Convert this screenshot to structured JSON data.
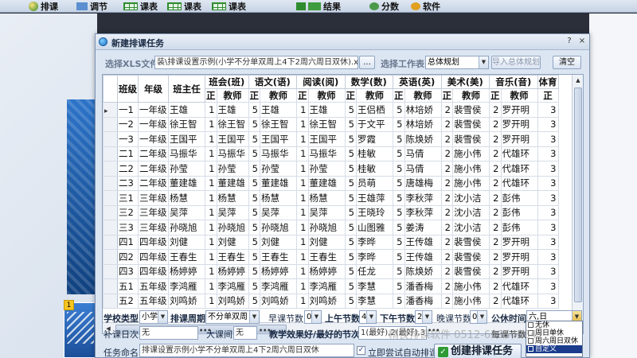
{
  "toolbar": {
    "items": [
      {
        "label": "排课"
      },
      {
        "label": "调节"
      },
      {
        "label": "课表"
      },
      {
        "label": "课表"
      },
      {
        "label": "课表"
      },
      {
        "label": "结果"
      },
      {
        "label": "分数"
      },
      {
        "label": "软件"
      }
    ]
  },
  "background": {
    "badge": "1"
  },
  "dialog": {
    "title": "新建排课任务",
    "controls": {
      "help": "?",
      "close": "×"
    },
    "xls_label": "选择XLS文件",
    "xls_path": "装\\排课设置示例(小学不分单双周上4下2周六周日双休).xls",
    "browse_btn": "...",
    "sheet_label": "选择工作表",
    "sheet_value": "总体规划",
    "import_btn": "导入总体规划",
    "clear_btn": "清空"
  },
  "grid": {
    "columns": [
      "班级",
      "年级",
      "班主任",
      "班会(班)",
      "",
      "语文(语)",
      "",
      "阅读(阅)",
      "",
      "数学(数)",
      "",
      "英语(英)",
      "",
      "美术(美)",
      "",
      "音乐(音)",
      "",
      "体育"
    ],
    "sub_headers": [
      "",
      "",
      "",
      "正",
      "教师",
      "正",
      "教师",
      "正",
      "教师",
      "正",
      "教师",
      "正",
      "教师",
      "正",
      "教师",
      "正",
      "教师",
      "正"
    ],
    "rows": [
      [
        "一1",
        "一年级",
        "王雄",
        "1",
        "王雄",
        "5",
        "王雄",
        "1",
        "王雄",
        "5",
        "王侣栖",
        "5",
        "林培娇",
        "2",
        "裴雪侯",
        "2",
        "罗开明",
        "3"
      ],
      [
        "一2",
        "一年级",
        "徐王智",
        "1",
        "徐王智",
        "5",
        "徐王智",
        "1",
        "徐王智",
        "5",
        "于文平",
        "5",
        "林培娇",
        "2",
        "裴雪侯",
        "2",
        "罗开明",
        "3"
      ],
      [
        "一3",
        "一年级",
        "王国平",
        "1",
        "王国平",
        "5",
        "王国平",
        "1",
        "王国平",
        "5",
        "罗霞",
        "5",
        "陈焕娇",
        "2",
        "裴雪侯",
        "2",
        "罗开明",
        "3"
      ],
      [
        "二1",
        "二年级",
        "马振华",
        "1",
        "马振华",
        "5",
        "马振华",
        "1",
        "马振华",
        "5",
        "桂敏",
        "5",
        "马倩",
        "2",
        "施小伟",
        "2",
        "代雄环",
        "3"
      ],
      [
        "二2",
        "二年级",
        "孙莹",
        "1",
        "孙莹",
        "5",
        "孙莹",
        "1",
        "孙莹",
        "5",
        "桂敏",
        "5",
        "马倩",
        "2",
        "施小伟",
        "2",
        "代雄环",
        "3"
      ],
      [
        "二3",
        "二年级",
        "董建雄",
        "1",
        "董建雄",
        "5",
        "董建雄",
        "1",
        "董建雄",
        "5",
        "员萌",
        "5",
        "唐雄梅",
        "2",
        "施小伟",
        "2",
        "代雄环",
        "3"
      ],
      [
        "三1",
        "三年级",
        "杨慧",
        "1",
        "杨慧",
        "5",
        "杨慧",
        "1",
        "杨慧",
        "5",
        "王雄萍",
        "5",
        "李秋萍",
        "2",
        "沈小洁",
        "2",
        "彭伟",
        "3"
      ],
      [
        "三2",
        "三年级",
        "吴萍",
        "1",
        "吴萍",
        "5",
        "吴萍",
        "1",
        "吴萍",
        "5",
        "王晓玲",
        "5",
        "李秋萍",
        "2",
        "沈小洁",
        "2",
        "彭伟",
        "3"
      ],
      [
        "三3",
        "三年级",
        "孙晓旭",
        "1",
        "孙晓旭",
        "5",
        "孙晓旭",
        "1",
        "孙晓旭",
        "5",
        "山图雅",
        "5",
        "姜涛",
        "2",
        "沈小洁",
        "2",
        "彭伟",
        "3"
      ],
      [
        "四1",
        "四年级",
        "刘健",
        "1",
        "刘健",
        "5",
        "刘健",
        "1",
        "刘健",
        "5",
        "李晔",
        "5",
        "王传雄",
        "2",
        "裴雪侯",
        "2",
        "罗开明",
        "3"
      ],
      [
        "四2",
        "四年级",
        "王春生",
        "1",
        "王春生",
        "5",
        "王春生",
        "1",
        "王春生",
        "5",
        "李晔",
        "5",
        "王传雄",
        "2",
        "裴雪侯",
        "2",
        "罗开明",
        "3"
      ],
      [
        "四3",
        "四年级",
        "杨婷婷",
        "1",
        "杨婷婷",
        "5",
        "杨婷婷",
        "1",
        "杨婷婷",
        "5",
        "任龙",
        "5",
        "陈焕娇",
        "2",
        "裴雪侯",
        "2",
        "罗开明",
        "3"
      ],
      [
        "五1",
        "五年级",
        "李鸿雁",
        "1",
        "李鸿雁",
        "5",
        "李鸿雁",
        "1",
        "李鸿雁",
        "5",
        "李慧",
        "5",
        "潘香梅",
        "2",
        "施小伟",
        "2",
        "代雄环",
        "3"
      ],
      [
        "五2",
        "五年级",
        "刘鸣娇",
        "1",
        "刘鸣娇",
        "5",
        "刘鸣娇",
        "1",
        "刘鸣娇",
        "5",
        "李慧",
        "5",
        "潘香梅",
        "2",
        "施小伟",
        "2",
        "代雄环",
        "3"
      ]
    ]
  },
  "bottom": {
    "school_type_label": "学校类型",
    "school_type_value": "小学",
    "cycle_label": "排课周期",
    "cycle_value": "不分单双周",
    "early_label": "早课节数",
    "early_value": "0",
    "am_label": "上午节数",
    "am_value": "4",
    "pm_label": "下午节数",
    "pm_value": "2",
    "evening_label": "晚课节数",
    "evening_value": "0",
    "holiday_label": "公休时间",
    "holiday_value": "六,日",
    "noclass_label": "补课日次",
    "noclass_value": "无",
    "bigclass_label": "大课间",
    "bigclass_value": "无",
    "best_label": "教学效果好/最好的节次",
    "best_value": "1(最好),2(最好),3,5",
    "task_label": "任务命名",
    "task_value": "排课设置示例小学不分单双周上4下2周六周日双休",
    "auto_label": "立即尝试自动排课",
    "auto_checked": "✓",
    "create_btn": "创建排课任务"
  },
  "popup": {
    "items": [
      "无休",
      "周日单休",
      "周六周日双休",
      "自定义"
    ],
    "selected": "自定义"
  },
  "watermark": "精良排课软件 0512-62954664",
  "overlap_label": "每课节数"
}
